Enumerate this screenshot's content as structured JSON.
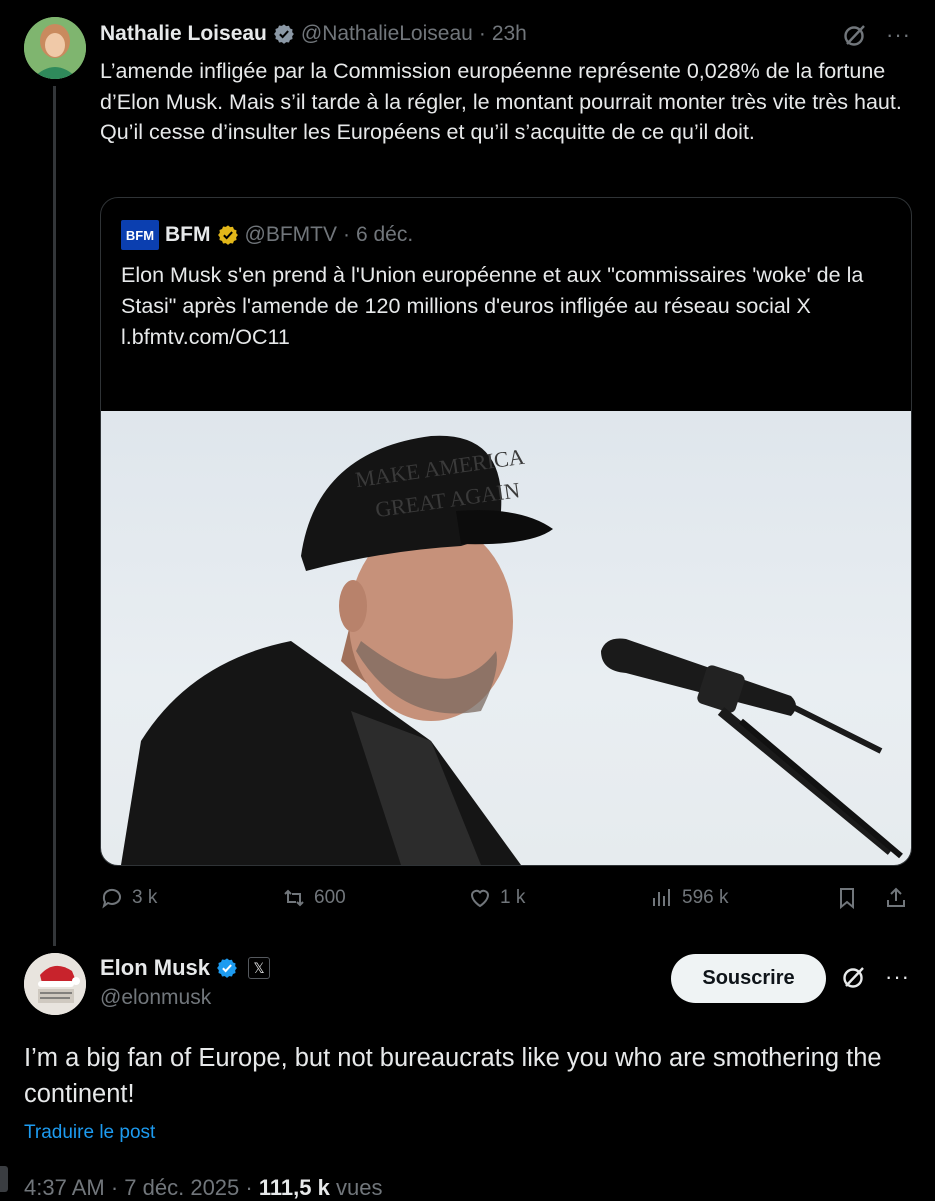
{
  "tweet1": {
    "author_name": "Nathalie Loiseau",
    "handle": "@NathalieLoiseau",
    "separator": "·",
    "time": "23h",
    "text": "L’amende infligée par la Commission européenne représente 0,028% de la fortune d’Elon Musk. Mais s’il tarde à la régler, le montant pourrait monter très vite très haut. Qu’il cesse d’insulter les Européens et qu’il s’acquitte de ce qu’il doit.",
    "more_label": "···",
    "quote": {
      "logo_text": "BFM",
      "author_name": "BFM",
      "handle": "@BFMTV",
      "separator": "·",
      "date": "6 déc.",
      "text": "Elon Musk s'en prend à l'Union européenne et aux \"commissaires 'woke' de la Stasi\" après l'amende de 120 millions d'euros infligée au réseau social X",
      "link": "l.bfmtv.com/OC11",
      "image_cap_text_line1": "MAKE AMERICA",
      "image_cap_text_line2": "GREAT AGAIN"
    },
    "actions": {
      "replies": "3 k",
      "reposts": "600",
      "likes": "1 k",
      "views": "596 k"
    }
  },
  "tweet2": {
    "author_name": "Elon Musk",
    "badge": "𝕏",
    "handle": "@elonmusk",
    "subscribe_label": "Souscrire",
    "more_label": "···",
    "text": "I’m a big fan of Europe, but not bureaucrats like you who are smothering the continent!",
    "translate_label": "Traduire le post",
    "time": "4:37 AM",
    "sep1": "·",
    "date": "7 déc. 2025",
    "sep2": "·",
    "views_count": "111,5 k",
    "views_label": "vues"
  },
  "colors": {
    "background": "#000000",
    "text": "#e7e9ea",
    "muted": "#71767b",
    "link": "#1d9bf0",
    "verified_blue": "#1d9bf0",
    "verified_gold": "#e2b719"
  }
}
